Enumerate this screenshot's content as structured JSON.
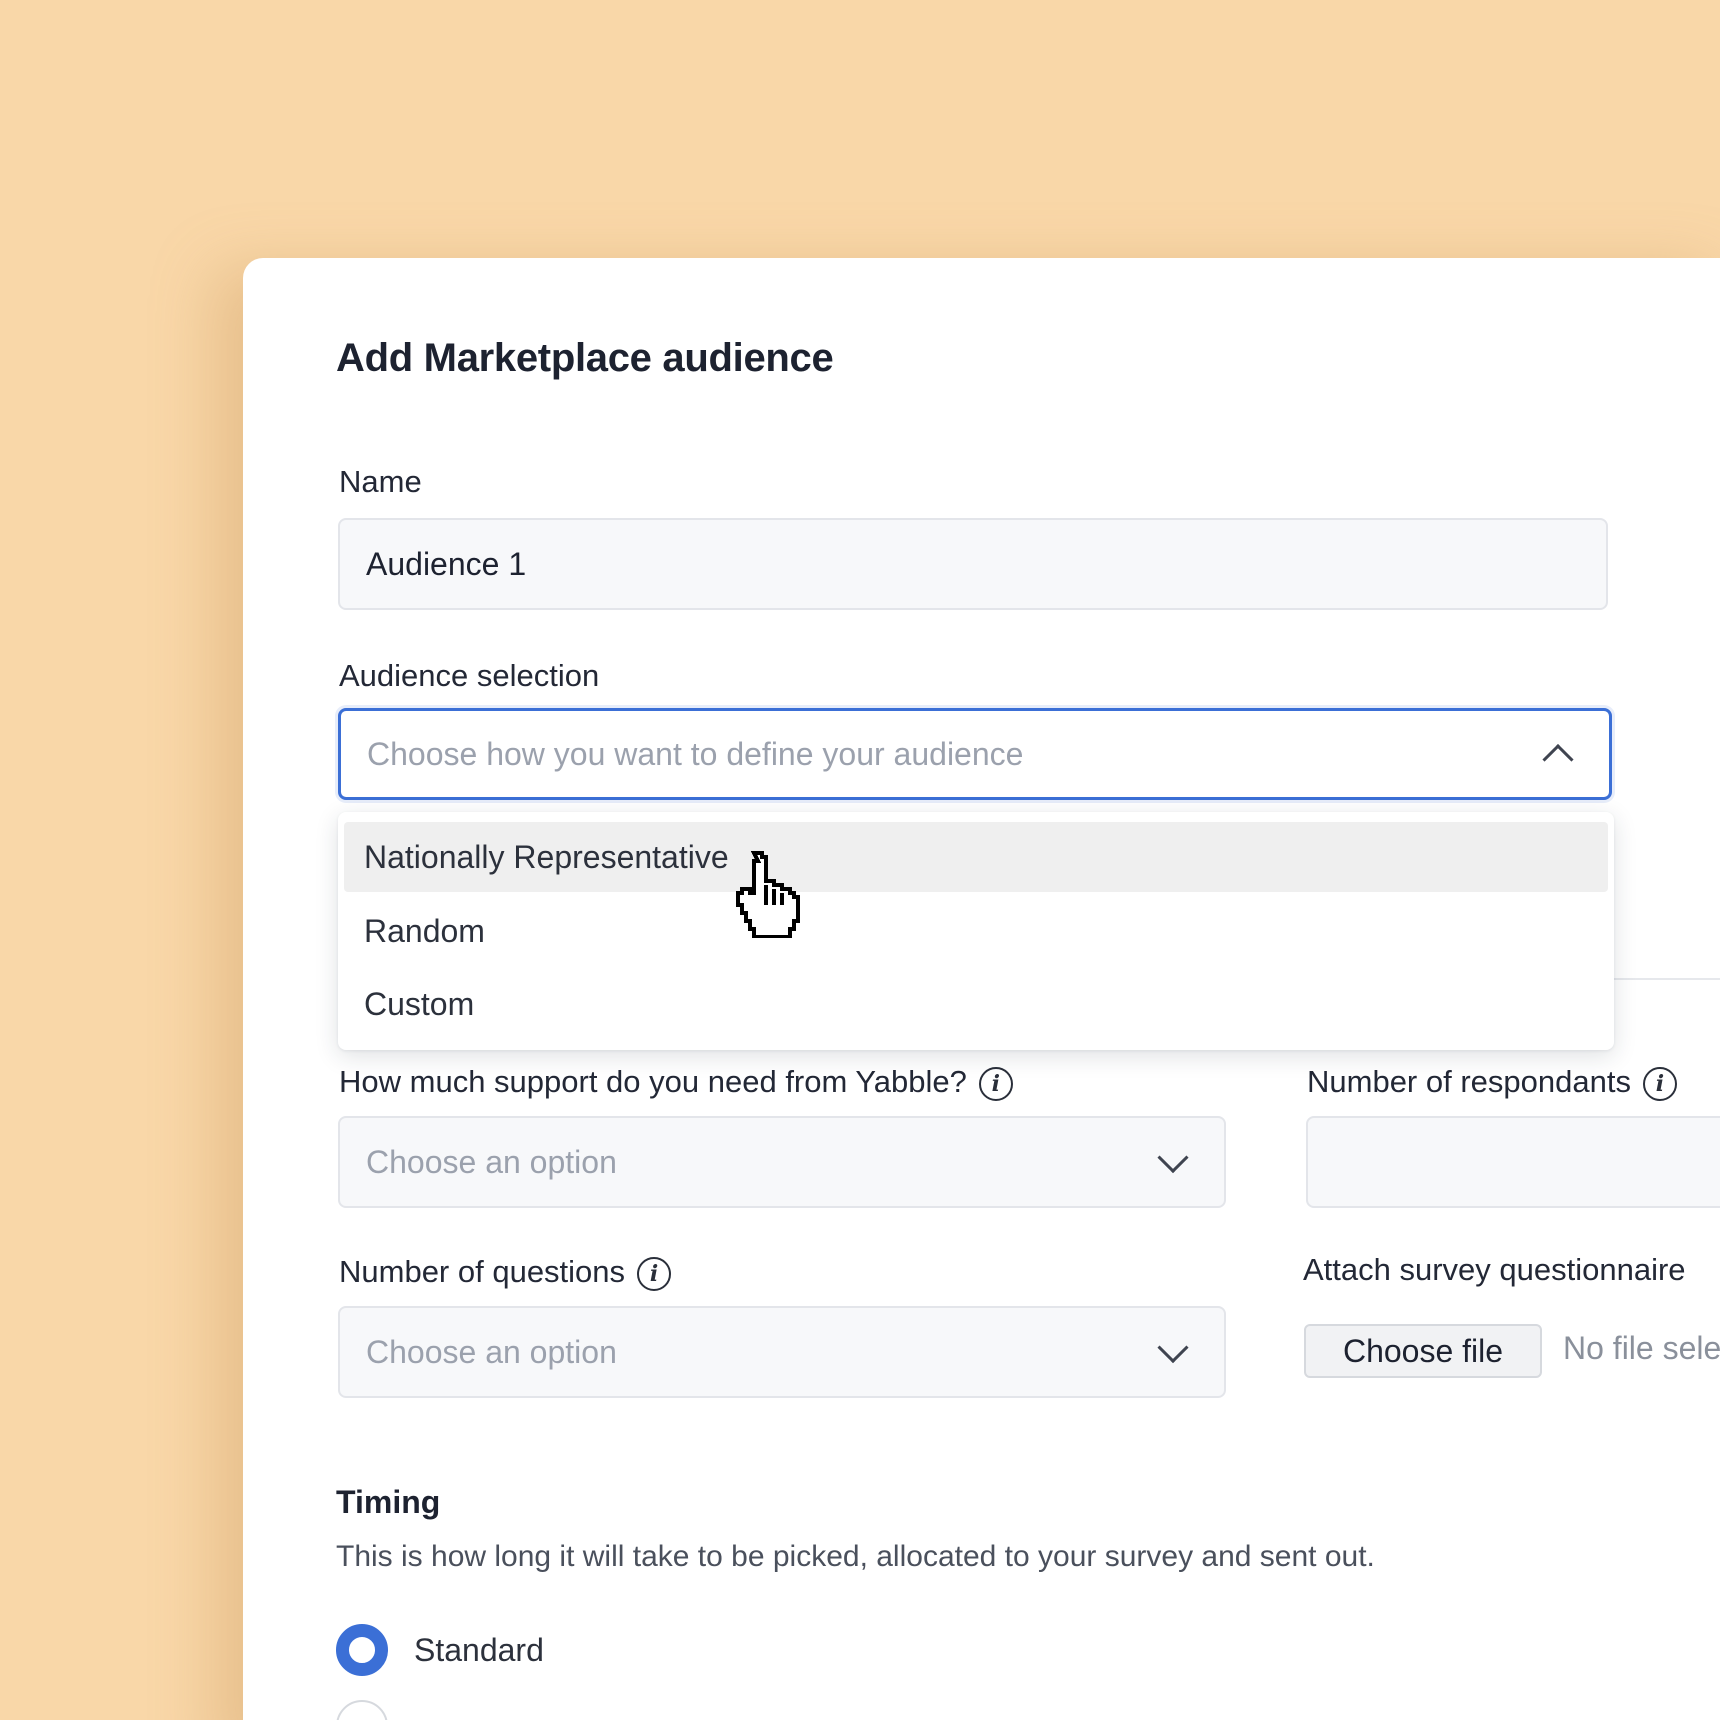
{
  "dialog": {
    "title": "Add Marketplace audience"
  },
  "name_field": {
    "label": "Name",
    "value": "Audience 1"
  },
  "audience_selection": {
    "label": "Audience selection",
    "placeholder": "Choose how you want to define your audience",
    "expanded": true,
    "options": [
      {
        "label": "Nationally Representative",
        "hovered": true
      },
      {
        "label": "Random",
        "hovered": false
      },
      {
        "label": "Custom",
        "hovered": false
      }
    ]
  },
  "support": {
    "label": "How much support do you need from Yabble?",
    "placeholder": "Choose an option"
  },
  "respondents": {
    "label": "Number of respondants",
    "value": ""
  },
  "questions": {
    "label": "Number of questions",
    "placeholder": "Choose an option"
  },
  "attachment": {
    "label": "Attach survey questionnaire",
    "button_label": "Choose file",
    "status": "No file sele"
  },
  "timing": {
    "title": "Timing",
    "description": "This is how long it will take to be picked, allocated to your survey and sent out.",
    "options": [
      {
        "label": "Standard",
        "selected": true
      }
    ]
  },
  "icons": {
    "info": "i"
  },
  "colors": {
    "background": "#f9d7a8",
    "accent": "#3b6fd6",
    "hover_option": "#efefef"
  }
}
